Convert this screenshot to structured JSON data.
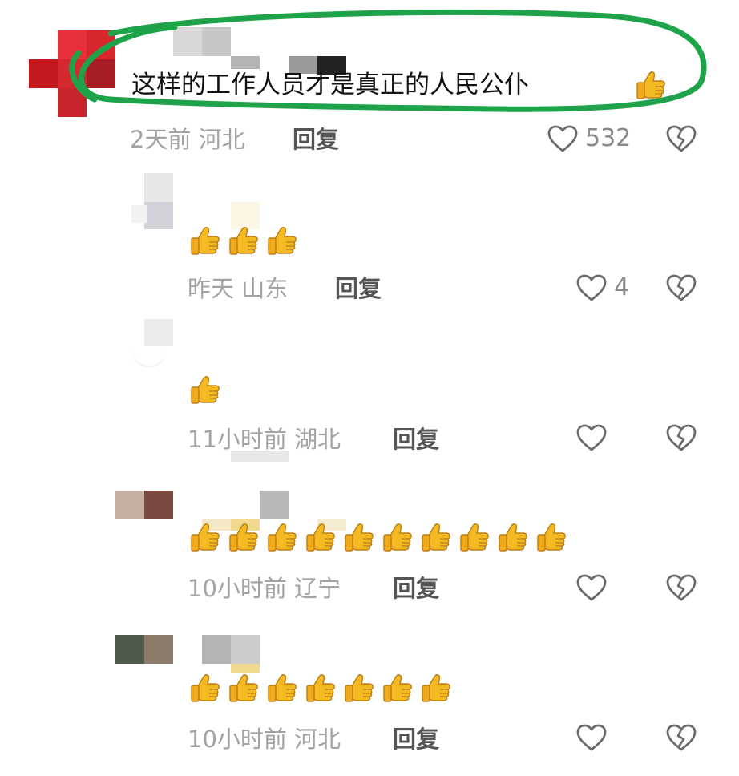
{
  "comments": [
    {
      "text": "这样的工作人员才是真正的人民公仆",
      "time": "2天前",
      "location": "河北",
      "reply_label": "回复",
      "likes": "532",
      "thumbs": 1
    },
    {
      "text": "",
      "time": "昨天",
      "location": "山东",
      "reply_label": "回复",
      "likes": "4",
      "thumbs": 3
    },
    {
      "text": "",
      "time": "11小时前",
      "location": "湖北",
      "reply_label": "回复",
      "likes": "",
      "thumbs": 1
    },
    {
      "text": "",
      "time": "10小时前",
      "location": "辽宁",
      "reply_label": "回复",
      "likes": "",
      "thumbs": 10
    },
    {
      "text": "",
      "time": "10小时前",
      "location": "河北",
      "reply_label": "回复",
      "likes": "",
      "thumbs": 7
    }
  ],
  "icons": {
    "like": "heart-outline-icon",
    "dislike": "broken-heart-icon",
    "emoji": "thumbs-up-emoji"
  },
  "colors": {
    "highlight_circle": "#1fa34a",
    "meta_text": "#a3a3a3",
    "reply_text": "#555555",
    "thumb_yellow": "#f5b921"
  }
}
